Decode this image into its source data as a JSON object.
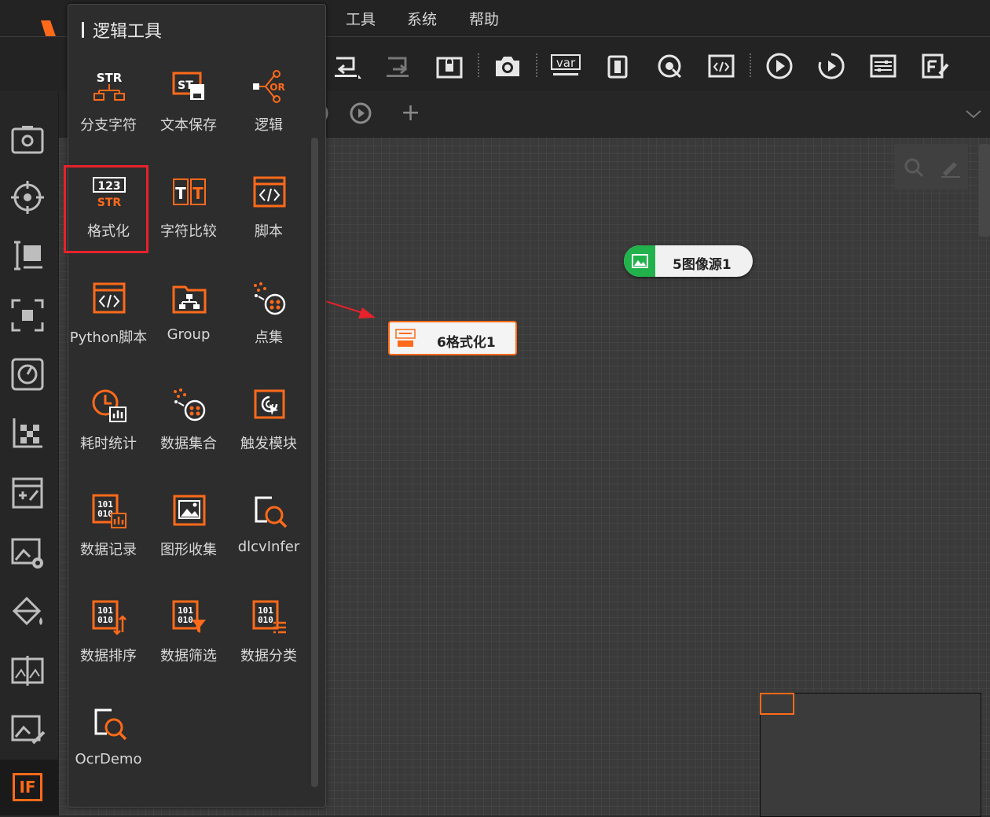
{
  "menu": {
    "items": [
      "工具",
      "系统",
      "帮助"
    ]
  },
  "toolbar": {
    "buttons": [
      "undo-icon",
      "redo-icon",
      "lock-icon",
      "camera-icon",
      "var-icon",
      "device-icon",
      "target-icon",
      "script-icon",
      "run-once-icon",
      "run-loop-icon",
      "settings-icon",
      "edit-f-icon"
    ],
    "var_label": "var"
  },
  "tabbar": {
    "add_label": "+"
  },
  "logic_panel": {
    "title": "逻辑工具",
    "tools": [
      {
        "label": "分支字符",
        "icon": "branch-string-icon"
      },
      {
        "label": "文本保存",
        "icon": "text-save-icon"
      },
      {
        "label": "逻辑",
        "icon": "logic-or-icon"
      },
      {
        "label": "格式化",
        "icon": "format-icon"
      },
      {
        "label": "字符比较",
        "icon": "string-compare-icon"
      },
      {
        "label": "脚本",
        "icon": "script-icon"
      },
      {
        "label": "Python脚本",
        "icon": "python-script-icon"
      },
      {
        "label": "Group",
        "icon": "group-icon"
      },
      {
        "label": "点集",
        "icon": "point-set-icon"
      },
      {
        "label": "耗时统计",
        "icon": "timing-stats-icon"
      },
      {
        "label": "数据集合",
        "icon": "data-collect-icon"
      },
      {
        "label": "触发模块",
        "icon": "trigger-icon"
      },
      {
        "label": "数据记录",
        "icon": "data-record-icon"
      },
      {
        "label": "图形收集",
        "icon": "graphic-collect-icon"
      },
      {
        "label": "dlcvInfer",
        "icon": "dlcv-infer-icon"
      },
      {
        "label": "数据排序",
        "icon": "data-sort-icon"
      },
      {
        "label": "数据筛选",
        "icon": "data-filter-icon"
      },
      {
        "label": "数据分类",
        "icon": "data-classify-icon"
      },
      {
        "label": "OcrDemo",
        "icon": "ocr-demo-icon"
      }
    ]
  },
  "canvas": {
    "nodes": [
      {
        "label": "5图像源1",
        "icon": "image-icon",
        "color": "#22b24c"
      },
      {
        "label": "6格式化1",
        "icon": "format-icon",
        "color": "#ff6a1a"
      }
    ]
  },
  "sidebar": {
    "active_label": "IF"
  },
  "colors": {
    "accent": "#ff6a1a",
    "highlight": "#e8222a",
    "node_green": "#22b24c"
  }
}
